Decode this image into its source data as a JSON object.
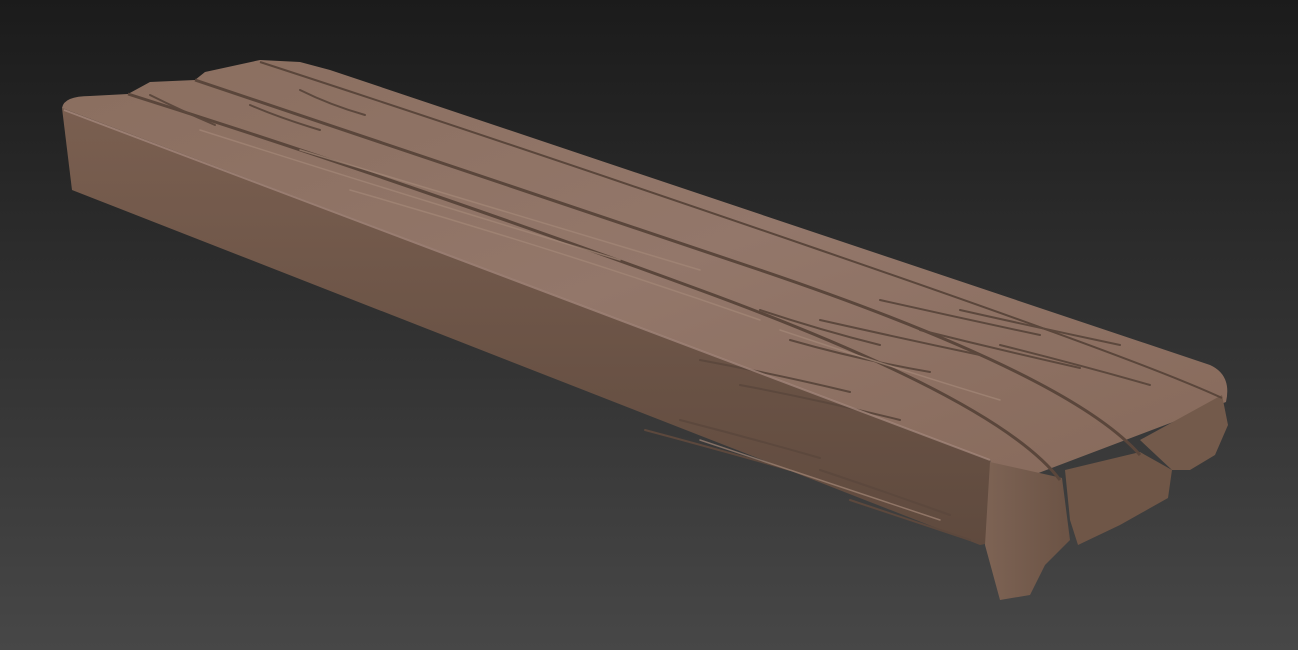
{
  "viewport": {
    "background_top": "#1b1b1b",
    "background_bottom": "#474747"
  },
  "model": {
    "material_color": "#8c7060",
    "highlight_color": "#a38676",
    "shadow_color": "#5e4a3f",
    "groove_color": "#4a3a31"
  }
}
